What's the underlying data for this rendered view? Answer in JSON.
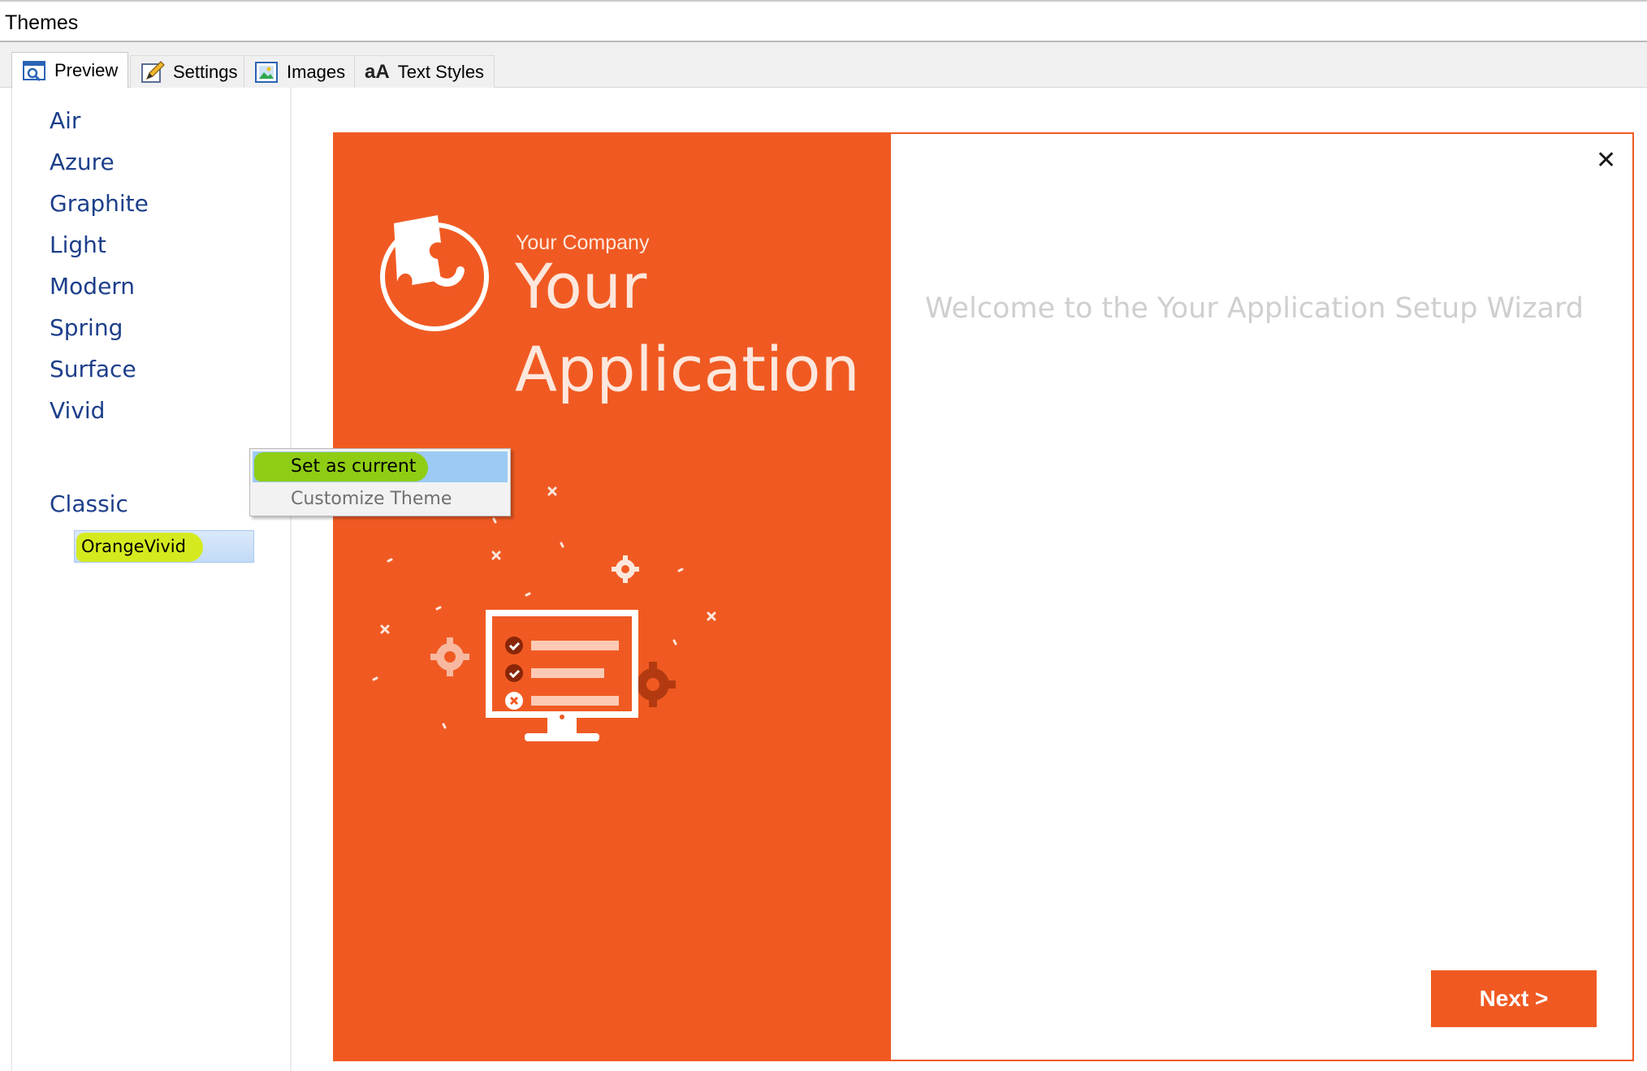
{
  "window": {
    "title": "Themes"
  },
  "tabs": [
    {
      "label": "Preview",
      "icon": "preview-icon",
      "active": true
    },
    {
      "label": "Settings",
      "icon": "pencil-icon",
      "active": false
    },
    {
      "label": "Images",
      "icon": "image-icon",
      "active": false
    },
    {
      "label": "Text Styles",
      "icon": "text-styles-icon",
      "glyph": "aA",
      "active": false
    }
  ],
  "themes": {
    "items": [
      "Air",
      "Azure",
      "Graphite",
      "Light",
      "Modern",
      "Spring",
      "Surface",
      "Vivid"
    ],
    "selected_sub_item": "OrangeVivid",
    "last_item": "Classic",
    "link_color": "#1d3f8a",
    "highlight_color": "#d4ea1f"
  },
  "context_menu": {
    "items": [
      {
        "label": "Set as current",
        "enabled": true,
        "hovered": true
      },
      {
        "label": "Customize Theme",
        "enabled": false,
        "hovered": false
      }
    ]
  },
  "preview": {
    "accent_color": "#f05a22",
    "company": "Your Company",
    "app_name_line1": "Your",
    "app_name_line2": "Application",
    "welcome": "Welcome to the Your Application Setup Wizard",
    "next_button": "Next >",
    "close_glyph": "✕"
  }
}
